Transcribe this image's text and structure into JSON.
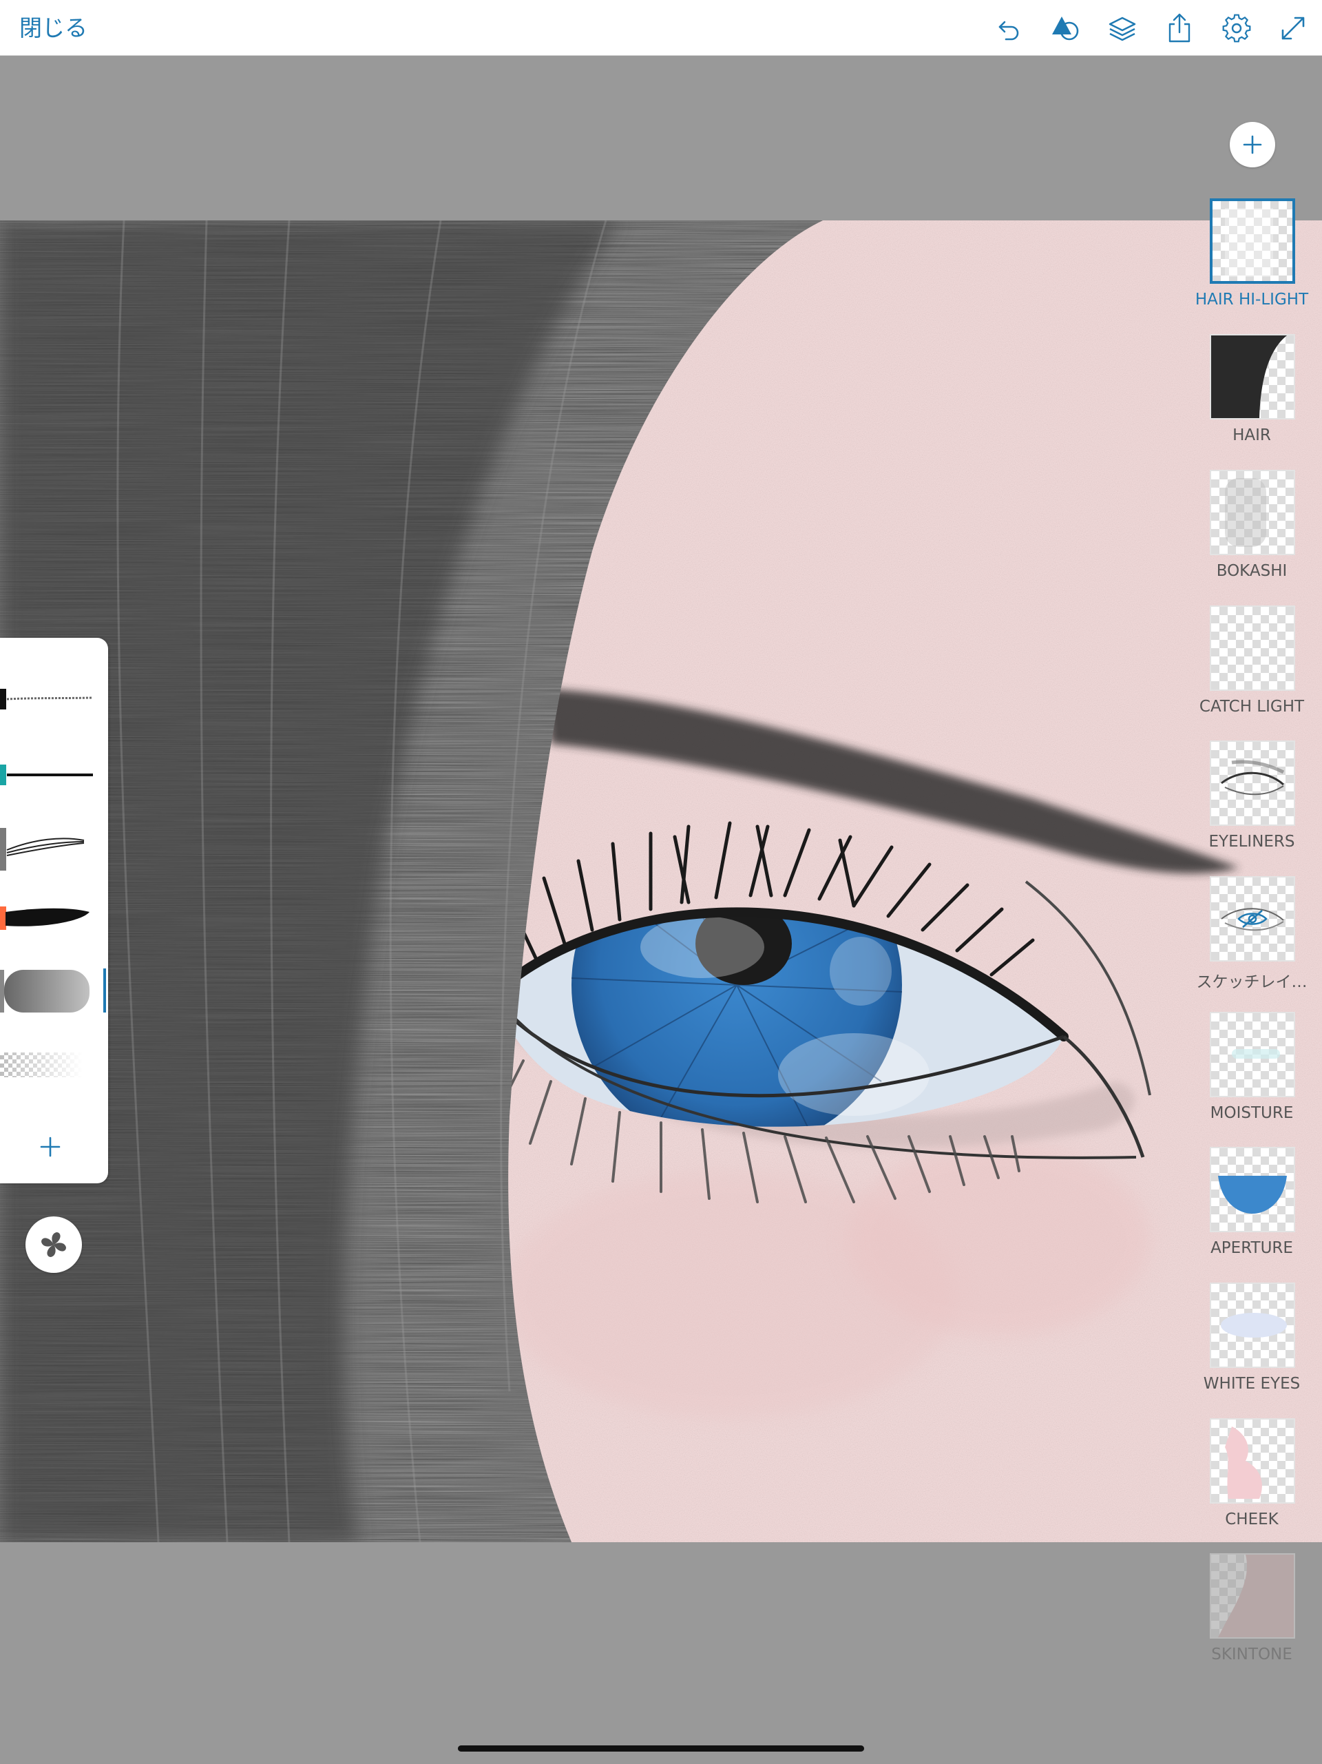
{
  "toolbar": {
    "close_label": "閉じる",
    "tools": [
      {
        "name": "undo",
        "icon": "undo-icon"
      },
      {
        "name": "shapes",
        "icon": "shapes-icon"
      },
      {
        "name": "layers",
        "icon": "layers-icon"
      },
      {
        "name": "share",
        "icon": "share-icon"
      },
      {
        "name": "settings",
        "icon": "gear-icon"
      },
      {
        "name": "fullscreen",
        "icon": "expand-icon"
      }
    ]
  },
  "layers": {
    "add_icon": "plus-icon",
    "items": [
      {
        "name": "HAIR HI-LIGHT",
        "active": true
      },
      {
        "name": "HAIR"
      },
      {
        "name": "BOKASHI"
      },
      {
        "name": "CATCH LIGHT"
      },
      {
        "name": "EYELINERS"
      },
      {
        "name": "スケッチレイ…"
      },
      {
        "name": "MOISTURE"
      },
      {
        "name": "APERTURE"
      },
      {
        "name": "WHITE EYES"
      },
      {
        "name": "CHEEK"
      },
      {
        "name": "SKINTONE"
      }
    ]
  },
  "brushes": {
    "items": [
      {
        "name": "pencil",
        "color": "#111111"
      },
      {
        "name": "ink-pen",
        "color": "#1aa5a5"
      },
      {
        "name": "sketch-brush",
        "color": "#7a7a7a"
      },
      {
        "name": "paint-brush",
        "color": "#ff6a3d"
      },
      {
        "name": "soft-brush",
        "color": "#888888",
        "active": true
      },
      {
        "name": "eraser",
        "color": "#bbbbbb"
      }
    ],
    "add_icon": "plus-icon"
  },
  "colors": {
    "accent": "#1f7ab3",
    "canvas_background": "#999999",
    "skin": "#f4dcdc"
  }
}
